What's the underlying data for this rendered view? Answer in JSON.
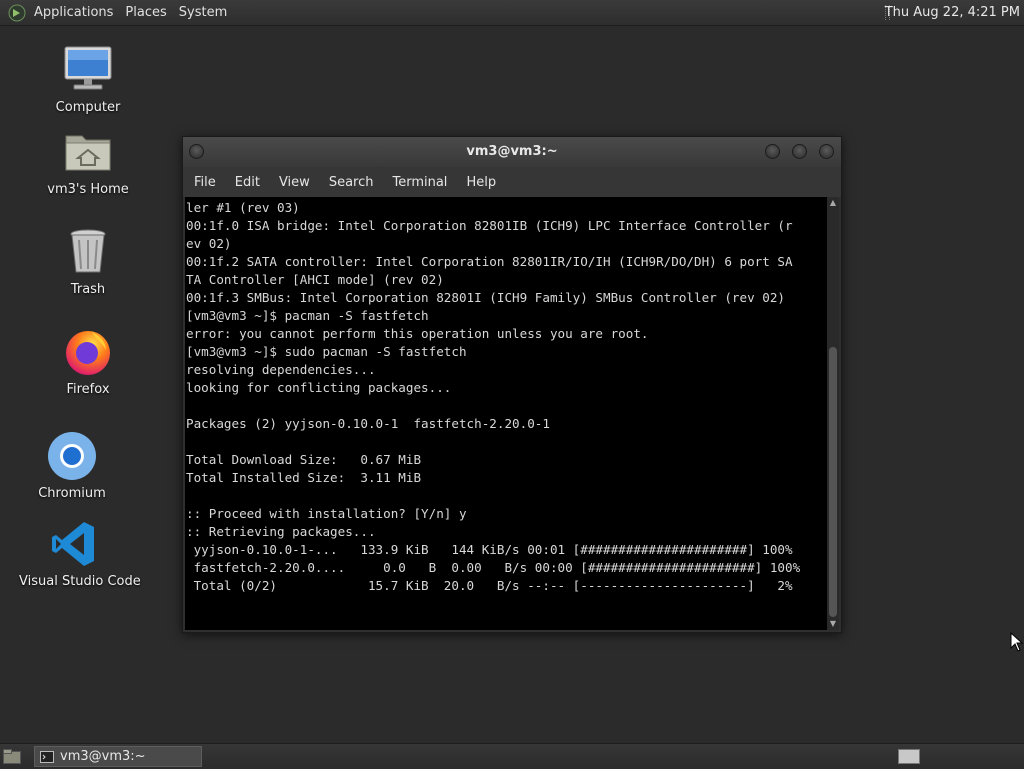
{
  "top_panel": {
    "menus": [
      "Applications",
      "Places",
      "System"
    ],
    "clock": "Thu Aug 22,  4:21 PM"
  },
  "desktop_icons": [
    {
      "label": "Computer",
      "icon": "computer-icon"
    },
    {
      "label": "vm3's Home",
      "icon": "home-folder-icon"
    },
    {
      "label": "Trash",
      "icon": "trash-icon"
    },
    {
      "label": "Firefox",
      "icon": "firefox-icon"
    },
    {
      "label": "Chromium",
      "icon": "chromium-icon"
    },
    {
      "label": "Visual Studio Code",
      "icon": "vscode-icon"
    }
  ],
  "terminal": {
    "title": "vm3@vm3:~",
    "menus": [
      "File",
      "Edit",
      "View",
      "Search",
      "Terminal",
      "Help"
    ],
    "lines": [
      "ler #1 (rev 03)",
      "00:1f.0 ISA bridge: Intel Corporation 82801IB (ICH9) LPC Interface Controller (r",
      "ev 02)",
      "00:1f.2 SATA controller: Intel Corporation 82801IR/IO/IH (ICH9R/DO/DH) 6 port SA",
      "TA Controller [AHCI mode] (rev 02)",
      "00:1f.3 SMBus: Intel Corporation 82801I (ICH9 Family) SMBus Controller (rev 02)",
      "[vm3@vm3 ~]$ pacman -S fastfetch",
      "error: you cannot perform this operation unless you are root.",
      "[vm3@vm3 ~]$ sudo pacman -S fastfetch",
      "resolving dependencies...",
      "looking for conflicting packages...",
      "",
      "Packages (2) yyjson-0.10.0-1  fastfetch-2.20.0-1",
      "",
      "Total Download Size:   0.67 MiB",
      "Total Installed Size:  3.11 MiB",
      "",
      ":: Proceed with installation? [Y/n] y",
      ":: Retrieving packages...",
      " yyjson-0.10.0-1-...   133.9 KiB   144 KiB/s 00:01 [######################] 100%",
      " fastfetch-2.20.0....     0.0   B  0.00   B/s 00:00 [######################] 100%",
      " Total (0/2)            15.7 KiB  20.0   B/s --:-- [----------------------]   2%"
    ]
  },
  "taskbar": {
    "window_button": "vm3@vm3:~"
  }
}
